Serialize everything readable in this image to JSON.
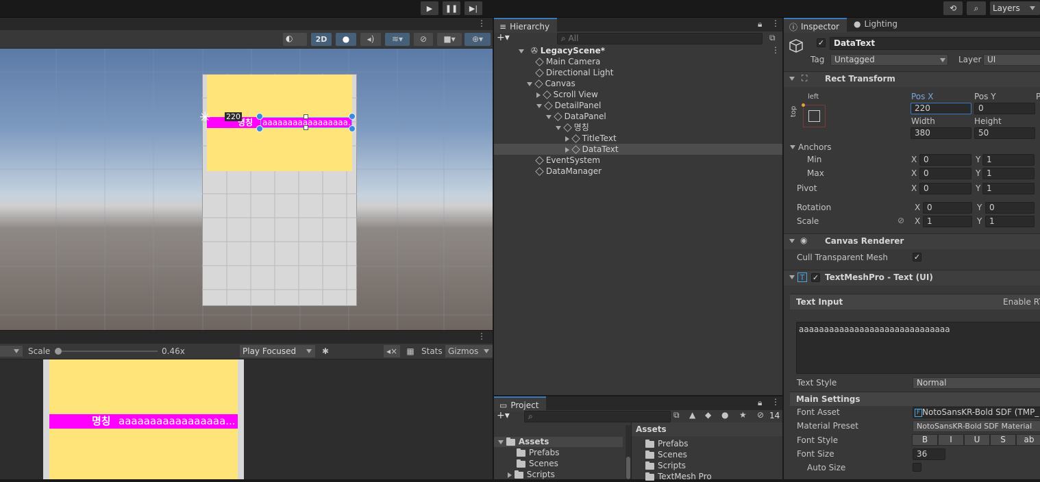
{
  "toolbar": {
    "layers_label": "Layers"
  },
  "scene_view": {
    "toolbar_2d": "2D",
    "pos_readout": "220",
    "row_title": "명칭",
    "row_value": "aaaaaaaaaaaaaaaaa...",
    "colors": {
      "panel_yellow": "#ffe47a",
      "row_magenta": "#ff00ff",
      "canvas_gray": "#d8d8d8"
    }
  },
  "game_view": {
    "scale_label": "Scale",
    "scale_value": "0.46x",
    "play_mode": "Play Focused",
    "stats_label": "Stats",
    "gizmos_label": "Gizmos",
    "row_title": "명칭",
    "row_value": "aaaaaaaaaaaaaaaaa..."
  },
  "hierarchy": {
    "tab_label": "Hierarchy",
    "search_placeholder": "All",
    "scene_name": "LegacyScene*",
    "items": [
      {
        "label": "Main Camera"
      },
      {
        "label": "Directional Light"
      },
      {
        "label": "Canvas"
      },
      {
        "label": "Scroll View"
      },
      {
        "label": "DetailPanel"
      },
      {
        "label": "DataPanel"
      },
      {
        "label": "명칭"
      },
      {
        "label": "TitleText"
      },
      {
        "label": "DataText"
      },
      {
        "label": "EventSystem"
      },
      {
        "label": "DataManager"
      }
    ]
  },
  "project": {
    "tab_label": "Project",
    "hidden_count": "14",
    "tree": [
      {
        "label": "Assets"
      },
      {
        "label": "Prefabs"
      },
      {
        "label": "Scenes"
      },
      {
        "label": "Scripts"
      }
    ],
    "assets_header": "Assets",
    "assets": [
      {
        "label": "Prefabs"
      },
      {
        "label": "Scenes"
      },
      {
        "label": "Scripts"
      },
      {
        "label": "TextMesh Pro"
      }
    ]
  },
  "inspector": {
    "tab_inspector": "Inspector",
    "tab_lighting": "Lighting",
    "object_name": "DataText",
    "tag_label": "Tag",
    "tag_value": "Untagged",
    "layer_label": "Layer",
    "layer_value": "UI",
    "rect_transform": {
      "title": "Rect Transform",
      "anchor_h": "left",
      "anchor_v": "top",
      "pos_x_label": "Pos X",
      "pos_y_label": "Pos Y",
      "pos_x": "220",
      "pos_y": "0",
      "width_label": "Width",
      "height_label": "Height",
      "width": "380",
      "height": "50",
      "anchors_label": "Anchors",
      "min_label": "Min",
      "max_label": "Max",
      "pivot_label": "Pivot",
      "rotation_label": "Rotation",
      "scale_label": "Scale",
      "x": "X",
      "y": "Y",
      "min_x": "0",
      "min_y": "1",
      "max_x": "0",
      "max_y": "1",
      "pivot_x": "0",
      "pivot_y": "1",
      "rot_x": "0",
      "rot_y": "0",
      "scale_x": "1",
      "scale_y": "1"
    },
    "canvas_renderer": {
      "title": "Canvas Renderer",
      "cull_label": "Cull Transparent Mesh"
    },
    "tmp": {
      "title": "TextMeshPro - Text (UI)",
      "text_input_label": "Text Input",
      "enable_rtl": "Enable RT",
      "text_value": "aaaaaaaaaaaaaaaaaaaaaaaaaaaaaa",
      "text_style_label": "Text Style",
      "text_style_value": "Normal",
      "main_settings": "Main Settings",
      "font_asset_label": "Font Asset",
      "font_asset_value": "NotoSansKR-Bold SDF (TMP_",
      "material_label": "Material Preset",
      "material_value": "NotoSansKR-Bold SDF Material",
      "font_style_label": "Font Style",
      "style_b": "B",
      "style_i": "I",
      "style_u": "U",
      "style_s": "S",
      "style_ab": "ab",
      "font_size_label": "Font Size",
      "font_size_value": "36",
      "auto_size_label": "Auto Size"
    }
  }
}
